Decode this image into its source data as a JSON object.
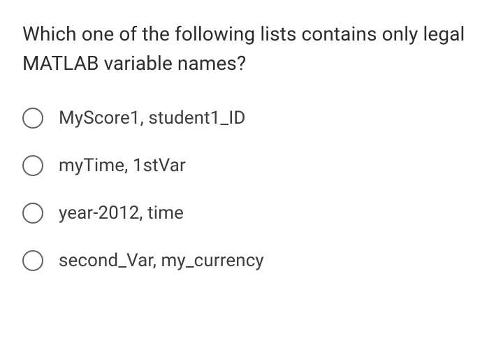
{
  "question": {
    "text": "Which one of the following lists contains only legal MATLAB variable names?"
  },
  "options": [
    {
      "label": "MyScore1, student1_ID"
    },
    {
      "label": "myTime, 1stVar"
    },
    {
      "label": "year-2012, time"
    },
    {
      "label": "second_Var, my_currency"
    }
  ]
}
